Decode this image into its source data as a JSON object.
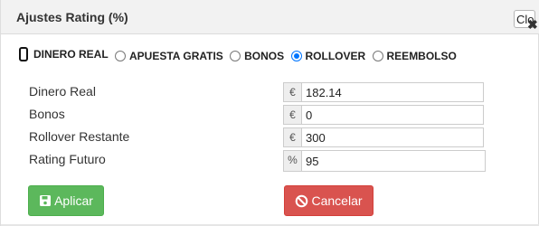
{
  "dialog": {
    "title": "Ajustes Rating (%)",
    "close_label": "Clos"
  },
  "options": [
    {
      "label": "DINERO REAL",
      "checked": false
    },
    {
      "label": "APUESTA GRATIS",
      "checked": false
    },
    {
      "label": "BONOS",
      "checked": false
    },
    {
      "label": "ROLLOVER",
      "checked": true
    },
    {
      "label": "REEMBOLSO",
      "checked": false
    }
  ],
  "fields": {
    "dinero_real": {
      "label": "Dinero Real",
      "unit": "€",
      "value": "182.14"
    },
    "bonos": {
      "label": "Bonos",
      "unit": "€",
      "value": "0"
    },
    "rollover": {
      "label": "Rollover Restante",
      "unit": "€",
      "value": "300"
    },
    "rating": {
      "label": "Rating Futuro",
      "unit": "%",
      "value": "95"
    }
  },
  "buttons": {
    "apply_label": "Aplicar",
    "cancel_label": "Cancelar"
  },
  "colors": {
    "apply": "#5cb85c",
    "cancel": "#d9534f",
    "radio_accent": "#0075ff"
  },
  "icons": {
    "apply": "save-icon",
    "cancel": "ban-icon",
    "close": "close-icon"
  }
}
